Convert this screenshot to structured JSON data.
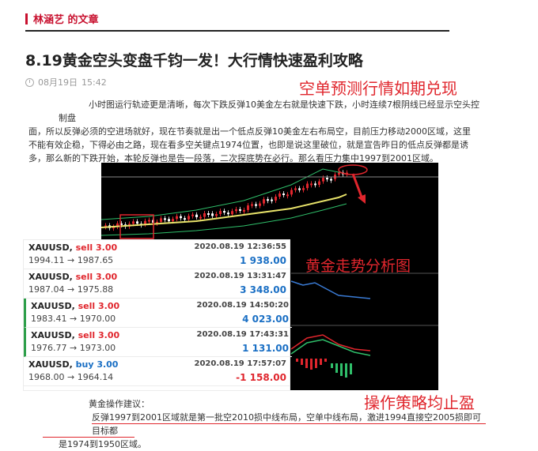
{
  "author": {
    "label": "林涵艺 的文章"
  },
  "article": {
    "title": "8.19黄金空头变盘千钧一发！大行情快速盈利攻略",
    "date": "08月19日",
    "time": "15:42",
    "paragraph_lines": [
      "小时图运行轨迹更是清晰，每次下跌反弹10美金左右就是快速下跌，小时连续7根阴线已经显示空头控制盘",
      "面，所以反弹必须的空进场就好，现在节奏就是出一个低点反弹10美金左右布局空，目前压力移动2000区域，这里",
      "不能有效企稳，下得必由之路，现在看多空关键点1974位置，也即是说这里破位，就是宣告昨日的低点反弹都是诱",
      "多，那么新的下跌开始，本轮反弹也是告一段落，二次探底势在必行。那么看压力集中1997到2001区域。"
    ],
    "advice_label": "黄金操作建议：",
    "advice_lines": [
      "反弹1997到2001区域就是第一批空2010损中线布局，空单中线布局，激进1994直接空2005损即可目标都",
      "是1974到1950区域。"
    ]
  },
  "annotations": {
    "top": "空单预测行情如期兑现",
    "middle": "黄金走势分析图",
    "bottom": "操作策略均止盈"
  },
  "trades": [
    {
      "symbol": "XAUUSD,",
      "action": "sell 3.00",
      "time": "2020.08.19 12:36:55",
      "prices": "1994.11 → 1987.65",
      "profit": "1 938.00"
    },
    {
      "symbol": "XAUUSD,",
      "action": "sell 3.00",
      "time": "2020.08.19 13:31:47",
      "prices": "1987.04 → 1975.88",
      "profit": "3 348.00"
    },
    {
      "symbol": "XAUUSD,",
      "action": "sell 3.00",
      "time": "2020.08.19 14:50:20",
      "prices": "1983.41 → 1970.00",
      "profit": "4 023.00"
    },
    {
      "symbol": "XAUUSD,",
      "action": "sell 3.00",
      "time": "2020.08.19 17:43:31",
      "prices": "1976.77 → 1973.00",
      "profit": "1 131.00"
    },
    {
      "symbol": "XAUUSD,",
      "action": "buy 3.00",
      "time": "2020.08.19 17:57:07",
      "prices": "1968.00 → 1964.14",
      "profit": "-1 158.00"
    }
  ],
  "colors": {
    "accent": "#c8102e",
    "annotation": "#e0262d",
    "profit": "#1a6fc4",
    "loss": "#e0262d",
    "chart_bg": "#000000"
  }
}
